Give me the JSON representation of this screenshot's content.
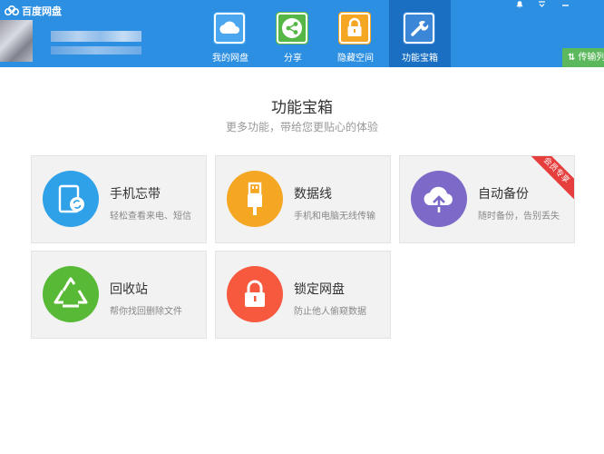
{
  "app": {
    "title": "百度网盘"
  },
  "nav": {
    "tabs": [
      {
        "label": "我的网盘",
        "icon": "cloud-icon",
        "color": "#4aa6ef"
      },
      {
        "label": "分享",
        "icon": "share-icon",
        "color": "#56b747"
      },
      {
        "label": "隐藏空间",
        "icon": "lock-icon",
        "color": "#f5a623"
      },
      {
        "label": "功能宝箱",
        "icon": "wrench-icon",
        "color": "#3b86d6"
      }
    ],
    "active": "功能宝箱"
  },
  "window_controls": [
    "bell-icon",
    "menu-icon",
    "minimize-icon"
  ],
  "transfer_button": {
    "label": "传输列"
  },
  "header": {
    "title": "功能宝箱",
    "subtitle": "更多功能，带给您更贴心的体验"
  },
  "features": [
    {
      "title": "手机忘带",
      "desc": "轻松查看来电、短信",
      "icon": "phone-sync-icon",
      "color": "#2fa1e8"
    },
    {
      "title": "数据线",
      "desc": "手机和电脑无线传输",
      "icon": "usb-icon",
      "color": "#f5a623"
    },
    {
      "title": "自动备份",
      "desc": "随时备份，告别丢失",
      "icon": "cloud-upload-icon",
      "color": "#7d6ac8",
      "badge": "会员专享"
    },
    {
      "title": "回收站",
      "desc": "帮你找回删除文件",
      "icon": "recycle-icon",
      "color": "#57b935"
    },
    {
      "title": "锁定网盘",
      "desc": "防止他人偷窥数据",
      "icon": "lock-icon",
      "color": "#f7593f"
    }
  ]
}
